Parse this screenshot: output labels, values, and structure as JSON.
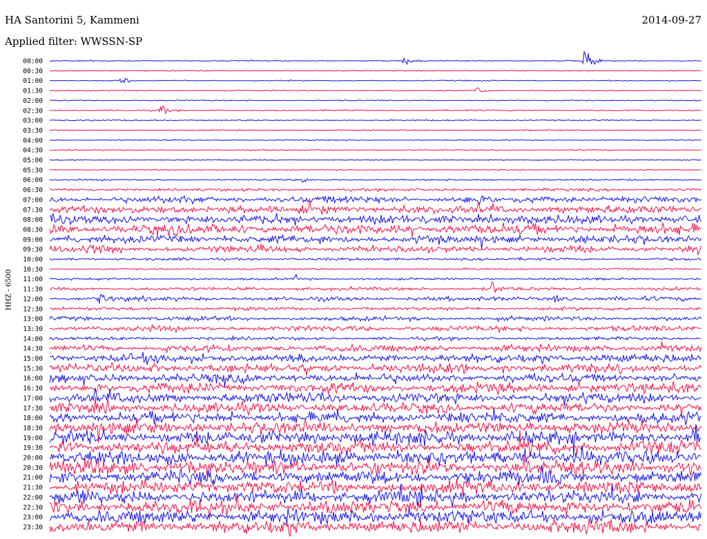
{
  "header": {
    "station": "HA Santorini 5, Kammeni",
    "filter_label": "Applied filter: WWSSN-SP",
    "date": "2014-09-27"
  },
  "axis": {
    "channel_label": "HHZ - 6500"
  },
  "colors": {
    "trace_a": "#1010e0",
    "trace_b": "#ee1144"
  },
  "chart_data": {
    "type": "line",
    "title": "HA Santorini 5, Kammeni",
    "subtitle": "Applied filter: WWSSN-SP",
    "date": "2014-09-27",
    "ylabel": "HHZ - 6500",
    "xlabel": "",
    "row_labels": [
      "00:00",
      "00:30",
      "01:00",
      "01:30",
      "02:00",
      "02:30",
      "03:00",
      "03:30",
      "04:00",
      "04:30",
      "05:00",
      "05:30",
      "06:00",
      "06:30",
      "07:00",
      "07:30",
      "08:00",
      "08:30",
      "09:00",
      "09:30",
      "10:00",
      "10:30",
      "11:00",
      "11:30",
      "12:00",
      "12:30",
      "13:00",
      "13:30",
      "14:00",
      "14:30",
      "15:00",
      "15:30",
      "16:00",
      "16:30",
      "17:00",
      "17:30",
      "18:00",
      "18:30",
      "19:00",
      "19:30",
      "20:00",
      "20:30",
      "21:00",
      "21:30",
      "22:00",
      "22:30",
      "23:00",
      "23:30"
    ],
    "noise_level": [
      1,
      1,
      1,
      1,
      1,
      1.2,
      1.2,
      1,
      1,
      1,
      1,
      1,
      1.5,
      2.5,
      6,
      7,
      8,
      9,
      7,
      6,
      2.5,
      1.5,
      2,
      3,
      4,
      3,
      4,
      5,
      3,
      6,
      8,
      8,
      8,
      9,
      9,
      9,
      10,
      11,
      12,
      12,
      13,
      13,
      12,
      12,
      12,
      12,
      12,
      12
    ],
    "events": [
      {
        "row": 0,
        "minute": 16.3,
        "amplitude": 12
      },
      {
        "row": 0,
        "minute": 24.6,
        "amplitude": 40
      },
      {
        "row": 2,
        "minute": 3.3,
        "amplitude": 12
      },
      {
        "row": 3,
        "minute": 19.7,
        "amplitude": 14
      },
      {
        "row": 5,
        "minute": 5.0,
        "amplitude": 20
      },
      {
        "row": 12,
        "minute": 11.6,
        "amplitude": 8
      },
      {
        "row": 19,
        "minute": 1.8,
        "amplitude": 18
      },
      {
        "row": 22,
        "minute": 11.3,
        "amplitude": 10
      },
      {
        "row": 23,
        "minute": 20.3,
        "amplitude": 22
      },
      {
        "row": 24,
        "minute": 2.3,
        "amplitude": 16
      },
      {
        "row": 24,
        "minute": 23.1,
        "amplitude": 14
      }
    ]
  }
}
